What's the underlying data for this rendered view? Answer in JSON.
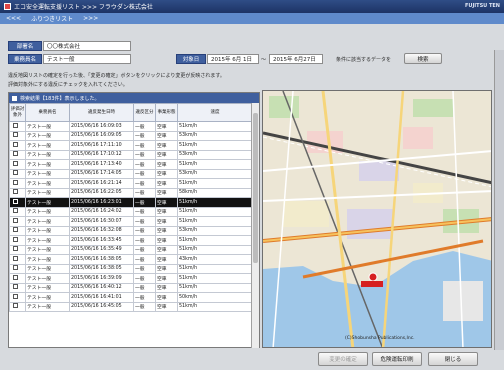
{
  "window": {
    "title": "エコ安全運転支援リスト >>> フラウダン株式会社",
    "brand": "FUJITSU TEN"
  },
  "nav": {
    "back": "<<<",
    "crumb": "ふりつきリスト",
    "forward": ">>>"
  },
  "filters": {
    "dept_label": "部署名",
    "dept_value": "〇〇株式会社",
    "driver_label": "乗務員名",
    "driver_value": "テスト一般",
    "date_label": "対象日",
    "date_from": "2015年 6月 1日",
    "date_to": "2015年 6月27日",
    "search_hint": "条件に該当するデータを",
    "search_button": "検索"
  },
  "instructions": {
    "line1": "違反地図リストの確定を行った後、「変更の確定」ボタンをクリックにより変更が反映されます。",
    "line2": "評価対象外にする違反にチェックを入れてください。"
  },
  "list": {
    "caption": "検索結果【183件】表示しました。",
    "headers": [
      "評価対象外",
      "乗務員名",
      "違反発生日時",
      "違反区分",
      "事業形態",
      "速度"
    ],
    "rows": [
      {
        "name": "テスト一般",
        "time": "2015/06/16 16:09:03",
        "type": "一般",
        "mode": "空車",
        "speed": "51km/h"
      },
      {
        "name": "テスト一般",
        "time": "2015/06/16 16:09:05",
        "type": "一般",
        "mode": "空車",
        "speed": "53km/h"
      },
      {
        "name": "テスト一般",
        "time": "2015/06/16 17:11:10",
        "type": "一般",
        "mode": "空車",
        "speed": "51km/h"
      },
      {
        "name": "テスト一般",
        "time": "2015/06/16 17:10:12",
        "type": "一般",
        "mode": "空車",
        "speed": "53km/h"
      },
      {
        "name": "テスト一般",
        "time": "2015/06/16 17:13:40",
        "type": "一般",
        "mode": "空車",
        "speed": "51km/h"
      },
      {
        "name": "テスト一般",
        "time": "2015/06/16 17:14:05",
        "type": "一般",
        "mode": "空車",
        "speed": "53km/h"
      },
      {
        "name": "テスト一般",
        "time": "2015/06/16 16:21:14",
        "type": "一般",
        "mode": "空車",
        "speed": "51km/h"
      },
      {
        "name": "テスト一般",
        "time": "2015/06/16 16:22:05",
        "type": "一般",
        "mode": "空車",
        "speed": "58km/h"
      },
      {
        "name": "テスト一般",
        "time": "2015/06/16 16:23:01",
        "type": "一般",
        "mode": "空車",
        "speed": "51km/h"
      },
      {
        "name": "テスト一般",
        "time": "2015/06/16 16:24:02",
        "type": "一般",
        "mode": "空車",
        "speed": "51km/h"
      },
      {
        "name": "テスト一般",
        "time": "2015/06/16 16:30:07",
        "type": "一般",
        "mode": "空車",
        "speed": "51km/h"
      },
      {
        "name": "テスト一般",
        "time": "2015/06/16 16:32:08",
        "type": "一般",
        "mode": "空車",
        "speed": "53km/h"
      },
      {
        "name": "テスト一般",
        "time": "2015/06/16 16:33:45",
        "type": "一般",
        "mode": "空車",
        "speed": "51km/h"
      },
      {
        "name": "テスト一般",
        "time": "2015/06/16 16:35:49",
        "type": "一般",
        "mode": "空車",
        "speed": "51km/h"
      },
      {
        "name": "テスト一般",
        "time": "2015/06/16 16:38:05",
        "type": "一般",
        "mode": "空車",
        "speed": "43km/h"
      },
      {
        "name": "テスト一般",
        "time": "2015/06/16 16:38:05",
        "type": "一般",
        "mode": "空車",
        "speed": "51km/h"
      },
      {
        "name": "テスト一般",
        "time": "2015/06/16 16:39:09",
        "type": "一般",
        "mode": "空車",
        "speed": "51km/h"
      },
      {
        "name": "テスト一般",
        "time": "2015/06/16 16:40:12",
        "type": "一般",
        "mode": "空車",
        "speed": "51km/h"
      },
      {
        "name": "テスト一般",
        "time": "2015/06/16 16:41:01",
        "type": "一般",
        "mode": "空車",
        "speed": "50km/h"
      },
      {
        "name": "テスト一般",
        "time": "2015/06/16 16:45:05",
        "type": "一般",
        "mode": "空車",
        "speed": "51km/h"
      }
    ],
    "selected_index": 8
  },
  "map": {
    "credit": "(C)Shobunsha Publications,Inc."
  },
  "footer": {
    "confirm_button": "変更の確定",
    "print_button": "危険運転印刷",
    "close_button": "閉じる"
  },
  "colors": {
    "titlebar": "#1d3365",
    "navbar": "#5f8acb",
    "label_bg": "#3f5f9e",
    "selected_row": "#121212"
  }
}
